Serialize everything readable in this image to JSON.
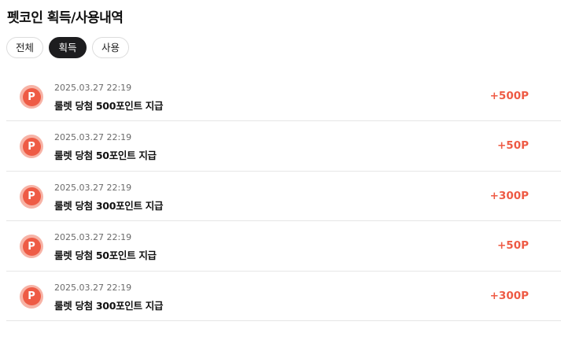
{
  "title": "펫코인 획득/사용내역",
  "tabs": [
    {
      "label": "전체",
      "active": false
    },
    {
      "label": "획득",
      "active": true
    },
    {
      "label": "사용",
      "active": false
    }
  ],
  "coin_glyph": "P",
  "colors": {
    "accent": "#ee5b45",
    "active_tab": "#1d1d1f"
  },
  "records": [
    {
      "date": "2025.03.27 22:19",
      "description": "룰렛 당첨 500포인트 지급",
      "amount": "+500P"
    },
    {
      "date": "2025.03.27 22:19",
      "description": "룰렛 당첨 50포인트 지급",
      "amount": "+50P"
    },
    {
      "date": "2025.03.27 22:19",
      "description": "룰렛 당첨 300포인트 지급",
      "amount": "+300P"
    },
    {
      "date": "2025.03.27 22:19",
      "description": "룰렛 당첨 50포인트 지급",
      "amount": "+50P"
    },
    {
      "date": "2025.03.27 22:19",
      "description": "룰렛 당첨 300포인트 지급",
      "amount": "+300P"
    }
  ]
}
